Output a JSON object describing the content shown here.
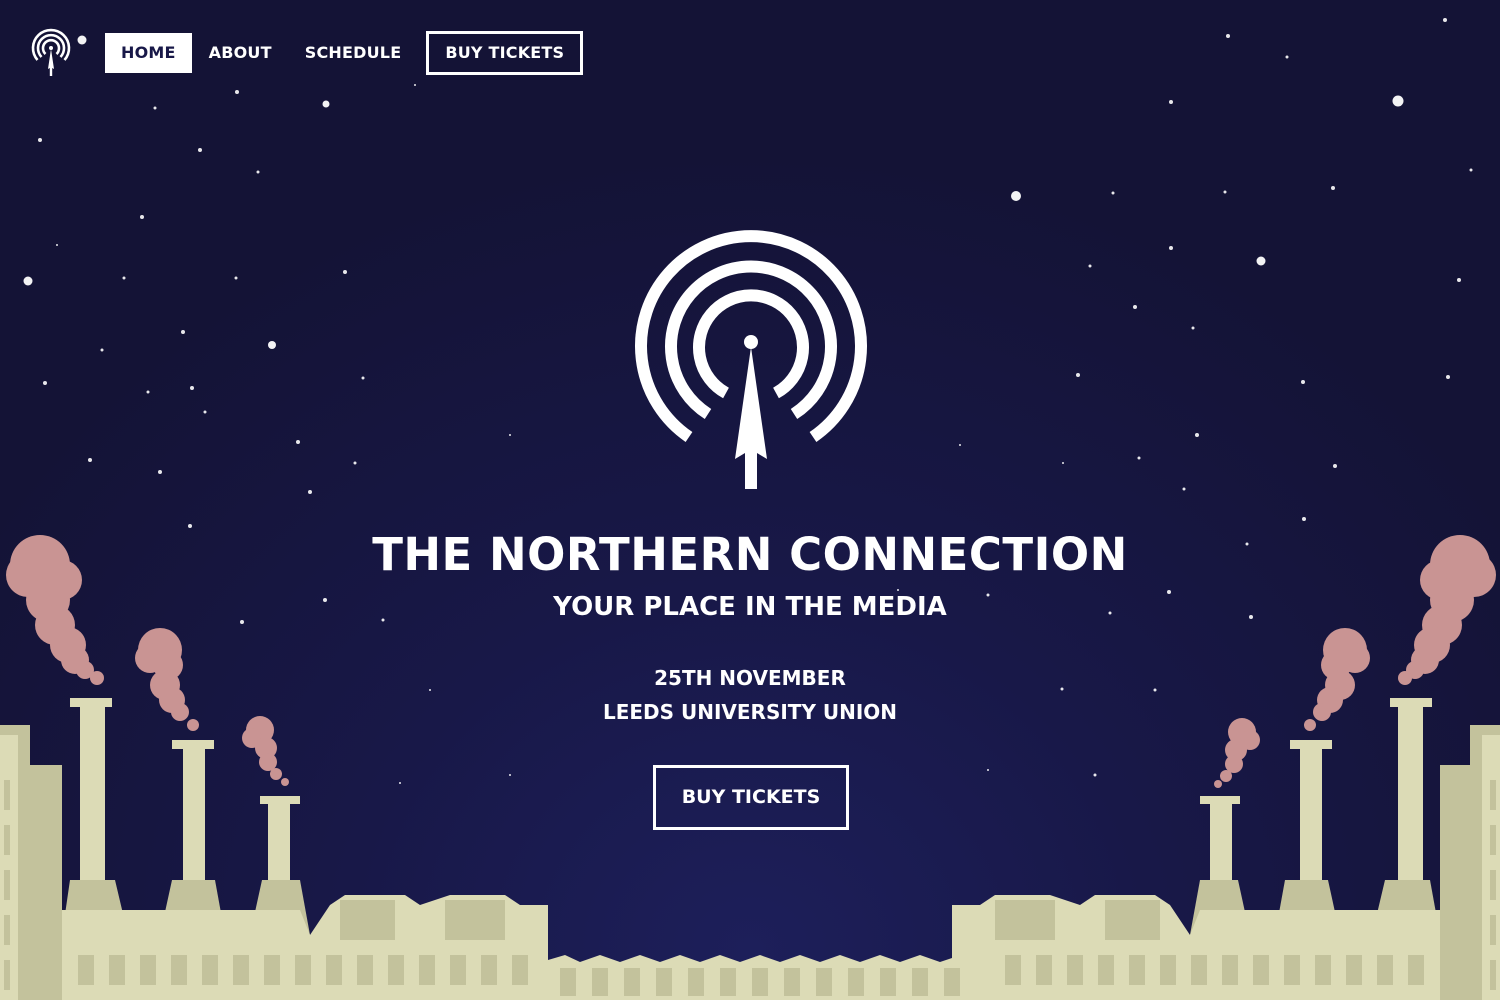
{
  "nav": {
    "logo_icon": "radio-tower-icon",
    "links": [
      {
        "label": "HOME",
        "active": true
      },
      {
        "label": "ABOUT",
        "active": false
      },
      {
        "label": "SCHEDULE",
        "active": false
      }
    ],
    "buy_label": "BUY TICKETS"
  },
  "hero": {
    "logo_icon": "radio-tower-icon",
    "title": "THE NORTHERN CONNECTION",
    "subtitle": "YOUR PLACE IN THE MEDIA",
    "date": "25TH NOVEMBER",
    "venue": "LEEDS UNIVERSITY UNION",
    "cta_label": "BUY TICKETS"
  },
  "colors": {
    "sky": "#181848",
    "text": "#ffffff",
    "smoke": "#c99493",
    "factory_light": "#dcdbb6",
    "factory_dark": "#c3c29c"
  }
}
